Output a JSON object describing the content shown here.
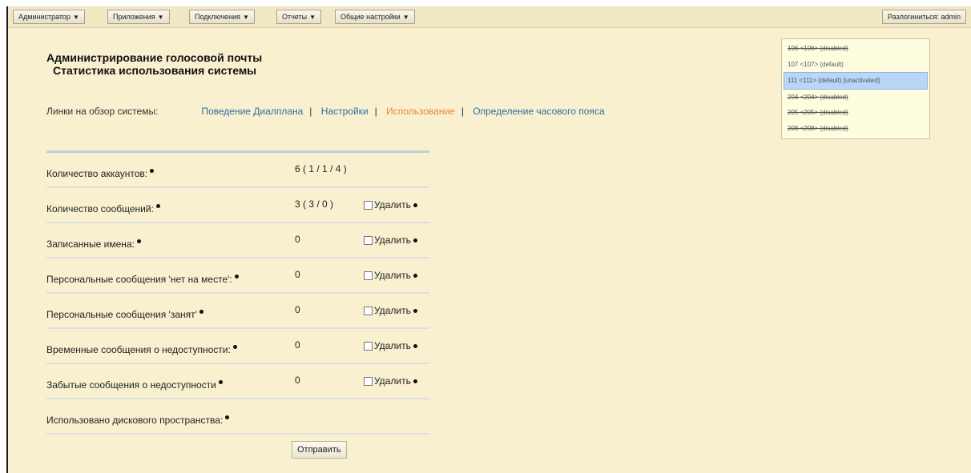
{
  "topbar": {
    "menus": [
      {
        "label": "Администратор"
      },
      {
        "label": "Приложения"
      },
      {
        "label": "Подключения"
      },
      {
        "label": "Отчеты"
      },
      {
        "label": "Общие настройки"
      }
    ],
    "dropdown_arrow": "▼",
    "logout": "Разлогиниться: admin"
  },
  "header": {
    "title": "Администрирование голосовой почты",
    "subtitle": "Статистика использования системы"
  },
  "links": {
    "label": "Линки на обзор системы:",
    "separator": "|",
    "items": [
      {
        "label": "Поведение Диалплана"
      },
      {
        "label": "Настройки"
      },
      {
        "label": "Использование"
      },
      {
        "label": "Определение часового пояса"
      }
    ]
  },
  "stats": {
    "delete_label": "Удалить",
    "rows": [
      {
        "label": "Количество аккаунтов:",
        "value": "6 ( 1 / 1 / 4 )"
      },
      {
        "label": "Количество сообщений:",
        "value": "3 ( 3 / 0 )"
      },
      {
        "label": "Записанные имена:",
        "value": "0"
      },
      {
        "label": "Персональные сообщения 'нет на месте':",
        "value": "0"
      },
      {
        "label": "Персональные сообщения 'занят'",
        "value": "0"
      },
      {
        "label": "Временные сообщения о недоступности:",
        "value": "0"
      },
      {
        "label": "Забытые сообщения о недоступности",
        "value": "0"
      },
      {
        "label": "Использовано дискового пространства:",
        "value": ""
      }
    ]
  },
  "submit": "Отправить",
  "mailboxes": [
    {
      "label": "106 <106> (disabled)"
    },
    {
      "label": "107 <107> (default)"
    },
    {
      "label": "111 <111> (default) [unactivated]"
    },
    {
      "label": "204 <204> (disabled)"
    },
    {
      "label": "205 <205> (disabled)"
    },
    {
      "label": "208 <208> (disabled)"
    }
  ]
}
